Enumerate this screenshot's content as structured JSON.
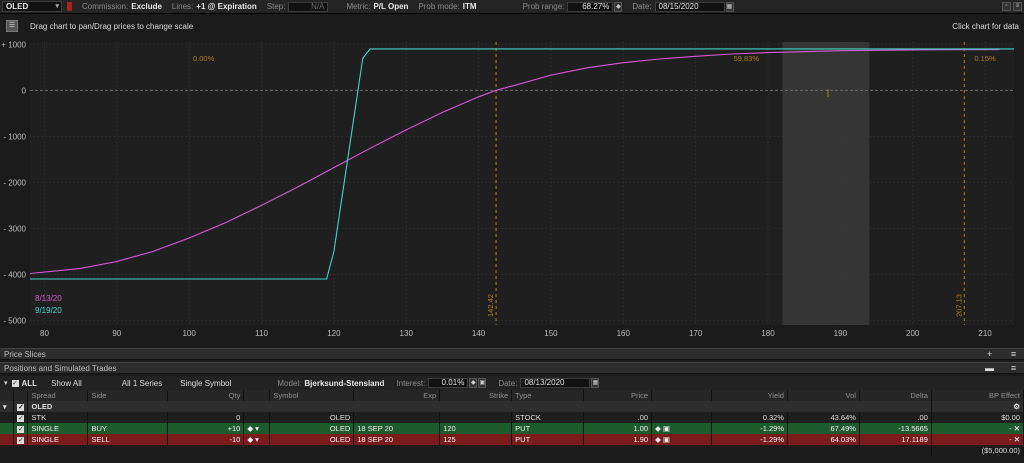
{
  "toolbar": {
    "symbol": "OLED",
    "commission_label": "Commission:",
    "commission_value": "Exclude",
    "lines_label": "Lines:",
    "lines_value": "+1 @ Expiration",
    "step_label": "Step:",
    "step_value": "N/A",
    "metric_label": "Metric:",
    "metric_value": "P/L Open",
    "prob_mode_label": "Prob mode:",
    "prob_mode_value": "ITM",
    "prob_range_label": "Prob range:",
    "prob_range_value": "68.27%",
    "date_label": "Date:",
    "date_value": "08/15/2020"
  },
  "chart_header": {
    "hint_left": "Drag chart to pan/Drag prices to change scale",
    "hint_right": "Click chart for data"
  },
  "chart_data": {
    "type": "line",
    "xlim": [
      78,
      214
    ],
    "ylim": [
      -5100,
      1050
    ],
    "x_ticks": [
      80,
      90,
      100,
      110,
      120,
      130,
      140,
      150,
      160,
      170,
      180,
      190,
      200,
      210
    ],
    "y_ticks": [
      1000,
      0,
      -1000,
      -2000,
      -3000,
      -4000,
      -5000
    ],
    "y_tick_labels": [
      "+ 1000",
      "0",
      "- 1000",
      "- 2000",
      "- 3000",
      "- 4000",
      "- 5000"
    ],
    "series": [
      {
        "name": "8/13/20",
        "color": "#d659d6",
        "x": [
          78,
          85,
          90,
          95,
          100,
          105,
          110,
          115,
          120,
          125,
          130,
          135,
          140,
          142.4,
          145,
          150,
          155,
          160,
          165,
          170,
          175,
          180,
          185,
          190,
          195,
          200,
          205,
          212
        ],
        "y": [
          -3980,
          -3870,
          -3720,
          -3500,
          -3210,
          -2880,
          -2500,
          -2100,
          -1680,
          -1260,
          -860,
          -480,
          -140,
          0,
          110,
          330,
          490,
          600,
          680,
          740,
          790,
          820,
          840,
          860,
          870,
          878,
          883,
          885
        ]
      },
      {
        "name": "9/19/20",
        "color": "#40d6cc",
        "x": [
          78,
          119,
          120,
          124,
          125,
          214
        ],
        "y": [
          -4100,
          -4100,
          -3500,
          700,
          900,
          900
        ]
      }
    ],
    "markers": [
      {
        "x": 142.42,
        "label": "142.42",
        "color": "#b08020"
      },
      {
        "x": 207.13,
        "label": "207.13",
        "color": "#b08020"
      }
    ],
    "prob_labels": [
      {
        "x": 102,
        "text": "0.00%"
      },
      {
        "x": 177,
        "text": "59.83%"
      },
      {
        "x": 210,
        "text": "0.15%"
      }
    ],
    "shade": [
      182,
      194
    ],
    "colors": {
      "plot_bg": "#1f1f1f",
      "grid": "#3a3a3a",
      "zero": "#6a6a6a",
      "axis_text": "#bdbdbd",
      "prob_text": "#b07a1e"
    }
  },
  "panels": {
    "price_slices": "Price Slices",
    "positions": "Positions and Simulated Trades"
  },
  "positions_bar": {
    "all": "ALL",
    "show": "Show All",
    "series": "All 1 Series",
    "symbol_mode": "Single Symbol",
    "model_label": "Model:",
    "model_value": "Bjerksund-Stensland",
    "interest_label": "Interest:",
    "interest_value": "0.01%",
    "date_label": "Date:",
    "date_value": "08/13/2020"
  },
  "table": {
    "headers": [
      "Spread",
      "Side",
      "Qty",
      "Symbol",
      "Exp",
      "Strike",
      "Type",
      "Price",
      "Yield",
      "Vol",
      "Delta",
      "BP Effect"
    ],
    "group": "OLED",
    "rows": [
      {
        "spread": "STK",
        "side": "",
        "qty": "0",
        "symbol": "OLED",
        "exp": "",
        "strike": "",
        "type": "STOCK",
        "price": ".00",
        "yield": "0.32%",
        "vol": "43.64%",
        "delta": ".00",
        "bp": "$0.00"
      },
      {
        "spread": "SINGLE",
        "side": "BUY",
        "qty": "+10",
        "symbol": "OLED",
        "exp": "18 SEP 20",
        "strike": "120",
        "type": "PUT",
        "price": "1.00",
        "yield": "-1.29%",
        "vol": "67.49%",
        "delta": "-13.5665",
        "bp": "-"
      },
      {
        "spread": "SINGLE",
        "side": "SELL",
        "qty": "-10",
        "symbol": "OLED",
        "exp": "18 SEP 20",
        "strike": "125",
        "type": "PUT",
        "price": "1.90",
        "yield": "-1.29%",
        "vol": "64.03%",
        "delta": "17.1189",
        "bp": "-"
      }
    ],
    "total_bp": "($5,000.00)"
  }
}
